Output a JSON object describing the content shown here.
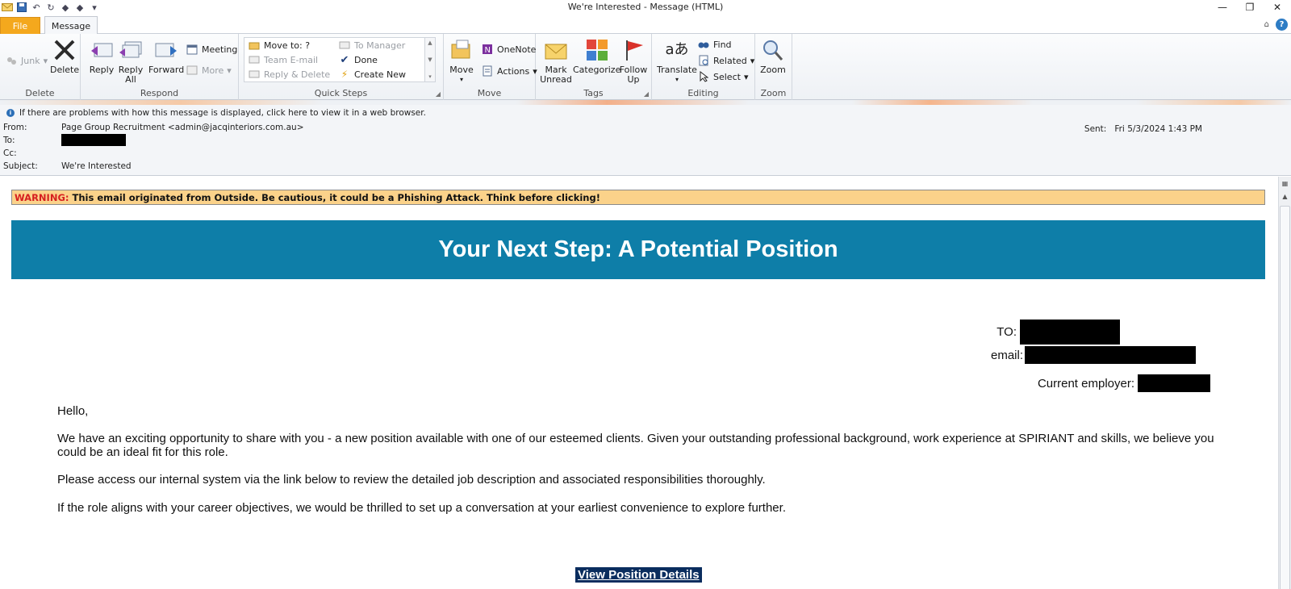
{
  "window": {
    "title": "We're Interested  -  Message (HTML)",
    "controls": [
      "minimize",
      "restore",
      "close"
    ]
  },
  "tabs": {
    "file": "File",
    "message": "Message"
  },
  "ribbon": {
    "delete_group": {
      "label": "Delete",
      "junk": "Junk",
      "delete": "Delete"
    },
    "respond_group": {
      "label": "Respond",
      "reply": "Reply",
      "reply_all": "Reply All",
      "forward": "Forward",
      "meeting": "Meeting",
      "more": "More"
    },
    "quicksteps_group": {
      "label": "Quick Steps",
      "move_to": "Move to: ?",
      "team_email": "Team E-mail",
      "reply_delete": "Reply & Delete",
      "to_manager": "To Manager",
      "done": "Done",
      "create_new": "Create New"
    },
    "move_group": {
      "label": "Move",
      "move": "Move",
      "onenote": "OneNote",
      "actions": "Actions"
    },
    "tags_group": {
      "label": "Tags",
      "mark_unread": "Mark Unread",
      "categorize": "Categorize",
      "follow_up": "Follow Up"
    },
    "editing_group": {
      "label": "Editing",
      "translate": "Translate",
      "find": "Find",
      "related": "Related",
      "select": "Select"
    },
    "zoom_group": {
      "label": "Zoom",
      "zoom": "Zoom"
    }
  },
  "header": {
    "info_bar": "If there are problems with how this message is displayed, click here to view it in a web browser.",
    "from_label": "From:",
    "from_value": "Page Group Recruitment <admin@jacqinteriors.com.au>",
    "to_label": "To:",
    "cc_label": "Cc:",
    "subject_label": "Subject:",
    "subject_value": "We're Interested",
    "sent_label": "Sent:",
    "sent_value": "Fri 5/3/2024 1:43 PM"
  },
  "body": {
    "warning_label": "WARNING:",
    "warning_text": "This email originated from Outside. Be cautious, it could be a Phishing Attack. Think before clicking!",
    "banner_title": "Your Next Step: A Potential Position",
    "to_label": "TO:",
    "email_label": "email:",
    "employer_label": "Current employer:",
    "greeting": "Hello,",
    "para1": "We have an exciting opportunity to share with you - a new position available with one of our esteemed clients. Given your outstanding professional background, work experience at SPIRIANT and skills, we believe you could be an ideal fit for this role.",
    "para2": "Please access our internal system via the link below to review the detailed job description and associated responsibilities thoroughly.",
    "para3": "If the role aligns with your career objectives, we would be thrilled to set up a conversation at your earliest convenience to explore further.",
    "cta": "View Position Details"
  }
}
